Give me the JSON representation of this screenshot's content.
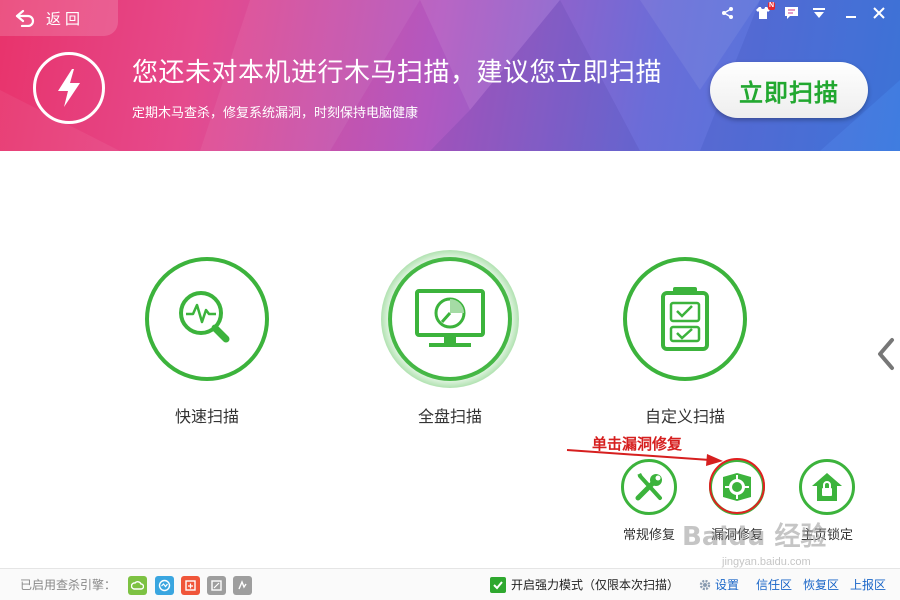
{
  "header": {
    "back_label": "返回",
    "headline": "您还未对本机进行木马扫描，建议您立即扫描",
    "subline": "定期木马查杀，修复系统漏洞，时刻保持电脑健康",
    "scan_now_label": "立即扫描",
    "window_controls": [
      "share-icon",
      "skin-icon",
      "message-icon",
      "menu-icon",
      "minimize-icon",
      "close-icon"
    ],
    "skin_badge": "N"
  },
  "scan_options": [
    {
      "label": "快速扫描",
      "icon": "quick-scan-icon",
      "active": false
    },
    {
      "label": "全盘扫描",
      "icon": "full-scan-icon",
      "active": true
    },
    {
      "label": "自定义扫描",
      "icon": "custom-scan-icon",
      "active": false
    }
  ],
  "tools": [
    {
      "label": "常规修复",
      "icon": "wrench-icon"
    },
    {
      "label": "漏洞修复",
      "icon": "shield-repair-icon"
    },
    {
      "label": "主页锁定",
      "icon": "home-lock-icon"
    }
  ],
  "annotation": "单击漏洞修复",
  "status": {
    "engines_label": "已启用查杀引擎：",
    "engines": [
      {
        "icon": "cloud-engine-icon",
        "color": "#7dc243"
      },
      {
        "icon": "qvm-engine-icon",
        "color": "#3aa6e0"
      },
      {
        "icon": "system-repair-engine-icon",
        "color": "#f0563a"
      },
      {
        "icon": "engine4-icon",
        "color": "#9e9e9e"
      },
      {
        "icon": "engine5-icon",
        "color": "#9e9e9e"
      }
    ],
    "mode_label": "开启强力模式（仅限本次扫描）",
    "settings_label": "设置",
    "links": [
      "信任区",
      "恢复区",
      "上报区"
    ]
  },
  "colors": {
    "accent_green": "#3cb33c",
    "link_blue": "#1a66c8",
    "annotation_red": "#d61f1f"
  },
  "watermark": {
    "main": "Baidu 经验",
    "sub": "jingyan.baidu.com"
  }
}
